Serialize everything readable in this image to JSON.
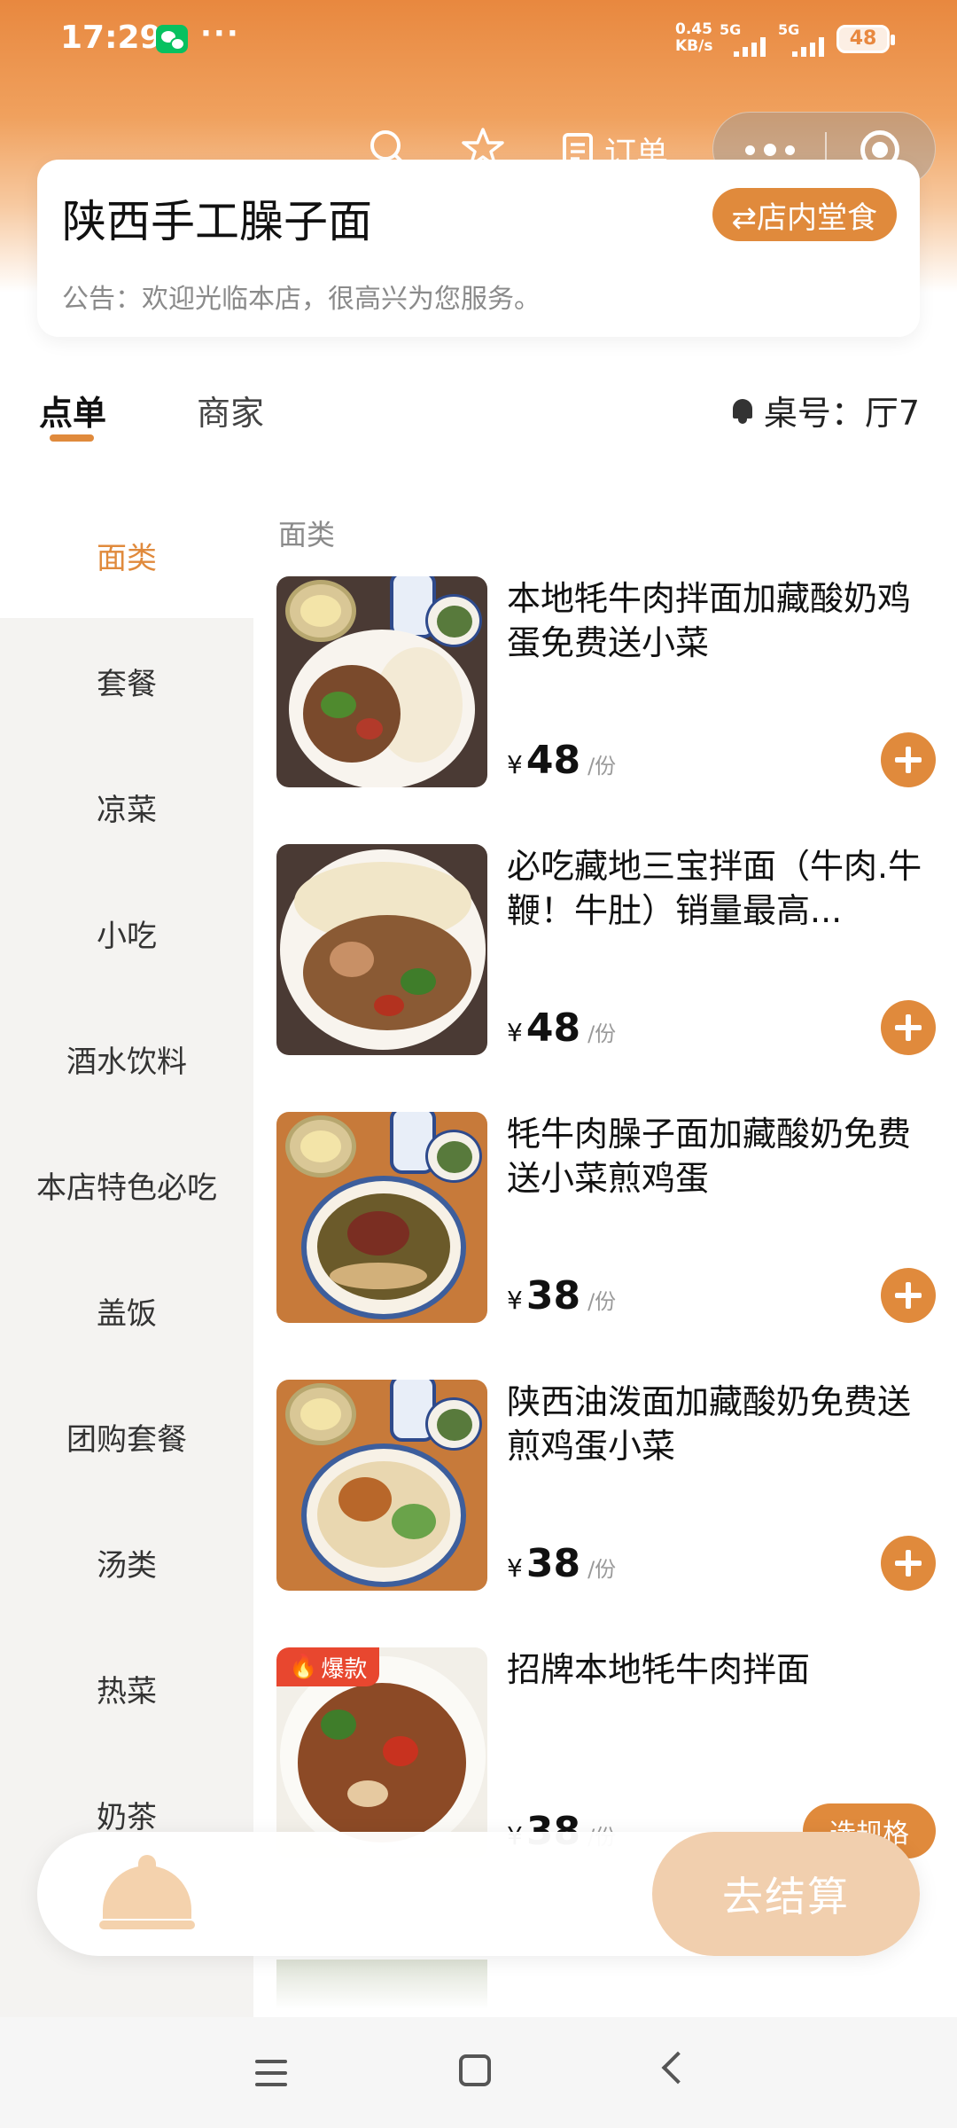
{
  "status_bar": {
    "time": "17:29",
    "more": "···",
    "net_speed": "0.45",
    "net_unit": "KB/s",
    "sig1_label": "5G",
    "sig2_label": "5G",
    "battery": "48"
  },
  "top_nav": {
    "orders_label": "订单"
  },
  "store": {
    "name": "陕西手工臊子面",
    "dine_mode": "⇄店内堂食",
    "notice": "公告：欢迎光临本店，很高兴为您服务。"
  },
  "tabs": {
    "order": "点单",
    "merchant": "商家",
    "table_label": "桌号：厅7"
  },
  "categories": [
    "面类",
    "套餐",
    "凉菜",
    "小吃",
    "酒水饮料",
    "本店特色必吃",
    "盖饭",
    "团购套餐",
    "汤类",
    "热菜",
    "奶茶"
  ],
  "active_category": "面类",
  "section_title": "面类",
  "dishes": [
    {
      "name": "本地牦牛肉拌面加藏酸奶鸡蛋免费送小菜",
      "currency": "¥",
      "price": "48",
      "unit": "/份"
    },
    {
      "name": "必吃藏地三宝拌面（牛肉.牛鞭！牛肚）销量最高...",
      "currency": "¥",
      "price": "48",
      "unit": "/份"
    },
    {
      "name": "牦牛肉臊子面加藏酸奶免费送小菜煎鸡蛋",
      "currency": "¥",
      "price": "38",
      "unit": "/份"
    },
    {
      "name": "陕西油泼面加藏酸奶免费送煎鸡蛋小菜",
      "currency": "¥",
      "price": "38",
      "unit": "/份"
    },
    {
      "name": "招牌本地牦牛肉拌面",
      "currency": "¥",
      "price": "38",
      "unit": "/份",
      "badge": "爆款",
      "action": "选规格"
    }
  ],
  "cart": {
    "checkout_label": "去结算"
  },
  "colors": {
    "accent": "#e08a3c",
    "hot_badge": "#e8472f"
  }
}
